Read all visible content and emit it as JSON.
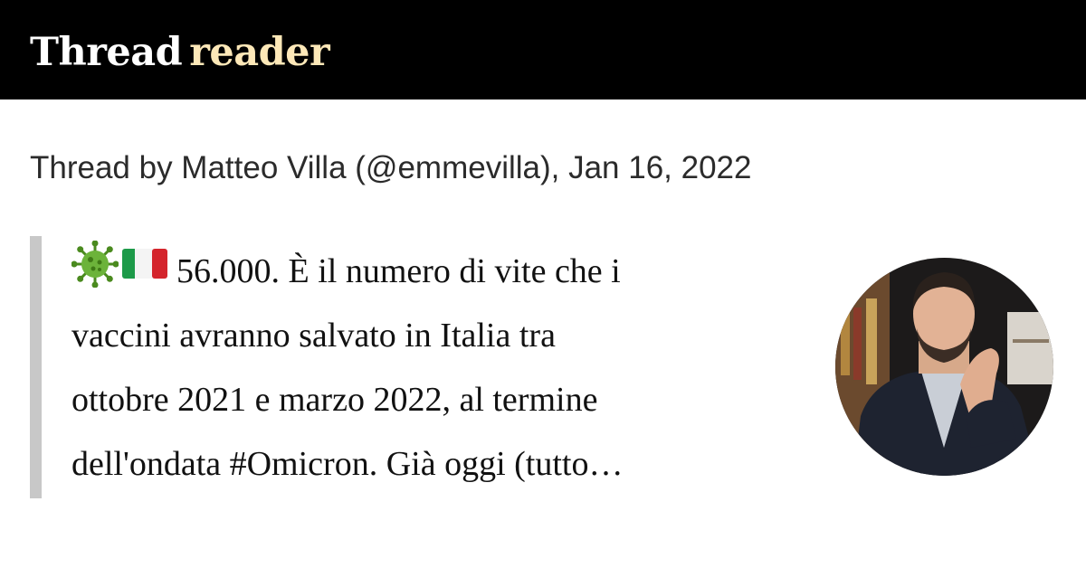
{
  "header": {
    "logo_part1": "Thread",
    "logo_part2": "reader",
    "background": "#000000",
    "accent": "#fde8b8"
  },
  "byline": "Thread by Matteo Villa (@emmevilla), Jan 16, 2022",
  "tweet": {
    "icons": [
      "virus-emoji",
      "italy-flag-emoji"
    ],
    "lines": [
      "56.000. È il numero di vite che i",
      "vaccini avranno salvato in Italia tra",
      "ottobre 2021 e marzo 2022, al termine",
      "dell'ondata #Omicron. Già oggi (tutto…"
    ]
  },
  "avatar": {
    "icon": "author-avatar"
  }
}
